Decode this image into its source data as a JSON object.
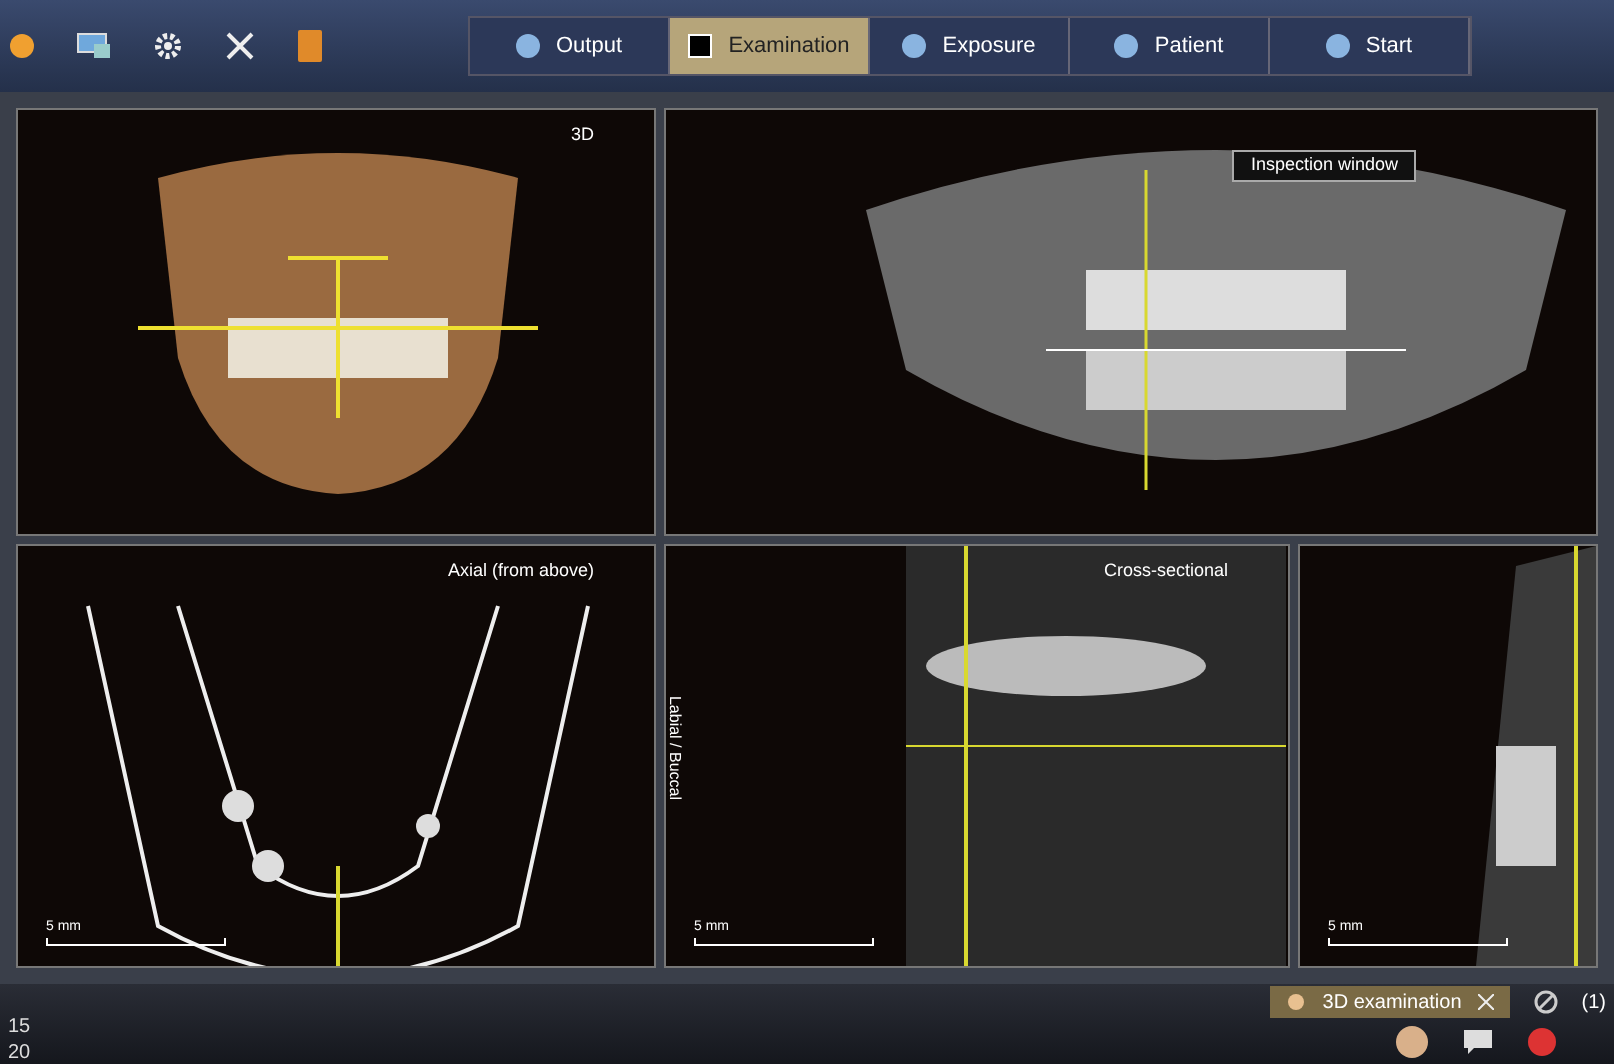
{
  "tabs": [
    {
      "label": "Output",
      "selected": false
    },
    {
      "label": "Examination",
      "selected": true
    },
    {
      "label": "Exposure",
      "selected": false
    },
    {
      "label": "Patient",
      "selected": false
    },
    {
      "label": "Start",
      "selected": false
    }
  ],
  "views_top": [
    {
      "kind": "volume",
      "title": "3D"
    },
    {
      "kind": "panoramic",
      "title": "Inspection window"
    }
  ],
  "views_bottom": [
    {
      "kind": "axial",
      "title": "Axial (from above)",
      "scale": "5 mm"
    },
    {
      "kind": "cross",
      "title": "Cross-sectional",
      "side_label": "Labial / Buccal",
      "scale": "5 mm"
    },
    {
      "kind": "slice",
      "scale": "5 mm"
    }
  ],
  "status_bar": {
    "count": "(1)",
    "task": "3D examination"
  },
  "clock": [
    "15",
    "20"
  ]
}
